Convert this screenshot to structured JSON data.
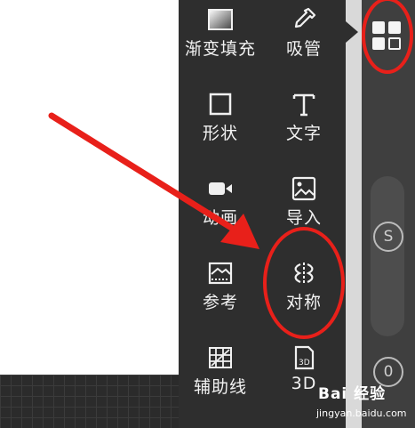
{
  "tools": [
    {
      "label": "渐变填充",
      "icon": "gradient-fill-icon"
    },
    {
      "label": "吸管",
      "icon": "eyedropper-icon"
    },
    {
      "label": "形状",
      "icon": "shape-icon"
    },
    {
      "label": "文字",
      "icon": "text-icon"
    },
    {
      "label": "动画",
      "icon": "animation-camera-icon"
    },
    {
      "label": "导入",
      "icon": "import-image-icon"
    },
    {
      "label": "参考",
      "icon": "reference-image-icon"
    },
    {
      "label": "对称",
      "icon": "symmetry-icon"
    },
    {
      "label": "辅助线",
      "icon": "guides-icon"
    },
    {
      "label": "3D",
      "icon": "3d-file-icon"
    }
  ],
  "rail": {
    "s_label": "S",
    "o_label": "0"
  },
  "watermark": {
    "brand": "Bai 经验",
    "url": "jingyan.baidu.com"
  },
  "colors": {
    "panel": "#2e2e2e",
    "annotation": "#e8201a"
  }
}
